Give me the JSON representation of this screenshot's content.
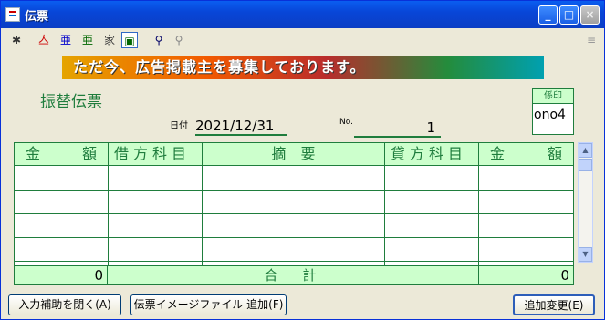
{
  "window": {
    "title": "伝票"
  },
  "title_buttons": {
    "minimize": "_",
    "maximize": "□",
    "close": "×"
  },
  "toolbar": {
    "items": [
      {
        "icon": "new-icon"
      },
      {
        "icon": "format-red-icon"
      },
      {
        "icon": "format-blue-icon"
      },
      {
        "icon": "format-green-icon"
      },
      {
        "icon": "format-house-icon"
      },
      {
        "icon": "export-icon"
      },
      {
        "icon": "search-icon"
      },
      {
        "icon": "search-next-icon"
      },
      {
        "icon": "settings-icon"
      }
    ]
  },
  "banner": {
    "text": "ただ今、広告掲載主を募集しております。"
  },
  "form": {
    "title": "振替伝票",
    "date_label": "日付",
    "date_value": "2021/12/31",
    "number_label": "No.",
    "number_value": "1",
    "stamp_label": "係印",
    "stamp_value": "ono4"
  },
  "table": {
    "headers": {
      "debit_amount": "金　額",
      "debit_account": "借方科目",
      "description": "摘　要",
      "credit_account": "貸方科目",
      "credit_amount": "金　額"
    },
    "rows": [
      [
        "",
        "",
        "",
        "",
        ""
      ],
      [
        "",
        "",
        "",
        "",
        ""
      ],
      [
        "",
        "",
        "",
        "",
        ""
      ],
      [
        "",
        "",
        "",
        "",
        ""
      ]
    ],
    "total_label": "合　計",
    "debit_total": "0",
    "credit_total": "0"
  },
  "buttons": {
    "input_assist": "入力補助を閉く(A)",
    "add_image_file": "伝票イメージファイル 追加(F)",
    "add_change": "追加変更(E)"
  },
  "colors": {
    "accent_green": "#1f7d3d",
    "header_bg": "#ccffcc",
    "titlebar": "#0846d8"
  }
}
